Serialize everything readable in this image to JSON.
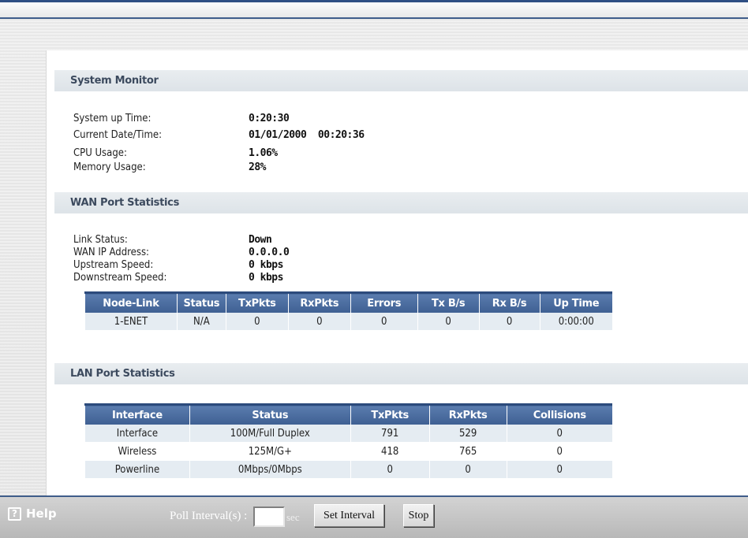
{
  "system_monitor": {
    "title": "System Monitor",
    "rows": [
      {
        "label": "System up Time:",
        "value": "0:20:30"
      },
      {
        "label": "Current Date/Time:",
        "value": "01/01/2000  00:20:36"
      },
      {
        "label": "CPU Usage:",
        "value": "1.06%"
      },
      {
        "label": "Memory Usage:",
        "value": "28%"
      }
    ]
  },
  "wan": {
    "title": "WAN Port Statistics",
    "rows": [
      {
        "label": "Link Status:",
        "value": "Down"
      },
      {
        "label": "WAN IP Address:",
        "value": "0.0.0.0"
      },
      {
        "label": "Upstream Speed:",
        "value": "0 kbps"
      },
      {
        "label": "Downstream Speed:",
        "value": "0 kbps"
      }
    ],
    "columns": [
      "Node-Link",
      "Status",
      "TxPkts",
      "RxPkts",
      "Errors",
      "Tx B/s",
      "Rx B/s",
      "Up Time"
    ],
    "cells": [
      [
        "1-ENET",
        "N/A",
        "0",
        "0",
        "0",
        "0",
        "0",
        "0:00:00"
      ]
    ]
  },
  "lan": {
    "title": "LAN Port Statistics",
    "columns": [
      "Interface",
      "Status",
      "TxPkts",
      "RxPkts",
      "Collisions"
    ],
    "cells": [
      [
        "Interface",
        "100M/Full Duplex",
        "791",
        "529",
        "0"
      ],
      [
        "Wireless",
        "125M/G+",
        "418",
        "765",
        "0"
      ],
      [
        "Powerline",
        "0Mbps/0Mbps",
        "0",
        "0",
        "0"
      ]
    ]
  },
  "footer": {
    "help_label": "Help",
    "help_icon": "?",
    "poll_label": "Poll Interval(s) :",
    "poll_value": "",
    "sec_label": "sec",
    "set_interval_label": "Set Interval",
    "stop_label": "Stop"
  }
}
